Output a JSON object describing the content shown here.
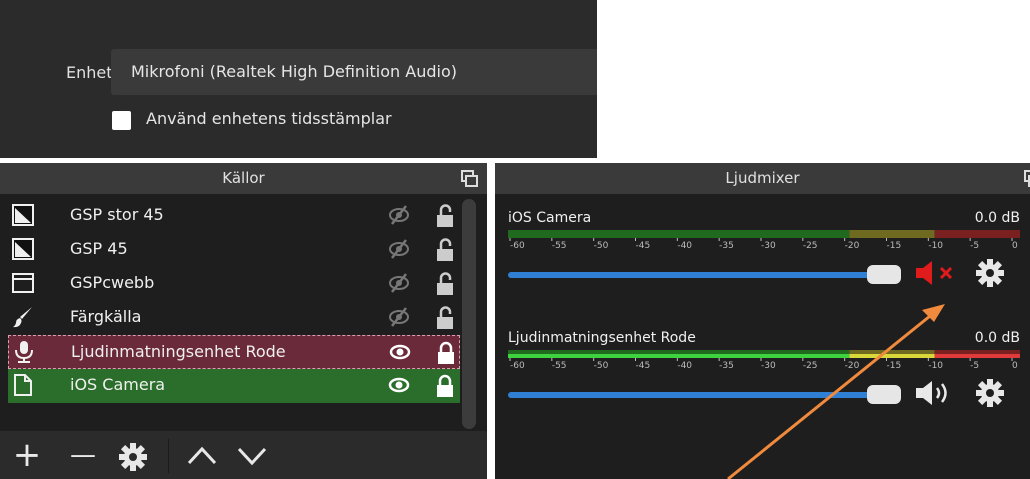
{
  "properties": {
    "device_label": "Enhet",
    "device_value": "Mikrofoni (Realtek High Definition Audio)",
    "timestamps_label": "Använd enhetens tidsstämplar",
    "timestamps_checked": false
  },
  "sources": {
    "title": "Källor",
    "items": [
      {
        "name": "GSP stor 45",
        "icon": "image-icon",
        "visible": false,
        "locked": false
      },
      {
        "name": "GSP 45",
        "icon": "image-icon",
        "visible": false,
        "locked": false
      },
      {
        "name": "GSPcwebb",
        "icon": "window-icon",
        "visible": false,
        "locked": false
      },
      {
        "name": "Färgkälla",
        "icon": "brush-icon",
        "visible": false,
        "locked": false
      },
      {
        "name": "Ljudinmatningsenhet Rode",
        "icon": "microphone-icon",
        "visible": true,
        "locked": true
      },
      {
        "name": "iOS Camera",
        "icon": "document-icon",
        "visible": true,
        "locked": true
      }
    ],
    "toolbar": {
      "add": "+",
      "remove": "—",
      "settings": "gear-icon",
      "up": "∧",
      "down": "∨"
    }
  },
  "mixer": {
    "title": "Ljudmixer",
    "channels": [
      {
        "name": "iOS Camera",
        "db": "0.0 dB",
        "muted": true,
        "level": 0.0
      },
      {
        "name": "Ljudinmatningsenhet Rode",
        "db": "0.0 dB",
        "muted": false,
        "level": 0.97
      }
    ],
    "scale": [
      "-60",
      "-55",
      "-50",
      "-45",
      "-40",
      "-35",
      "-30",
      "-25",
      "-20",
      "-15",
      "-10",
      "-5",
      "0"
    ]
  },
  "colors": {
    "accent_blue": "#2f7fd4",
    "selected_audio": "#6a2a3a",
    "selected_green": "#2b6e2b",
    "muted_red": "#e01b1b",
    "arrow": "#f08a3c"
  }
}
